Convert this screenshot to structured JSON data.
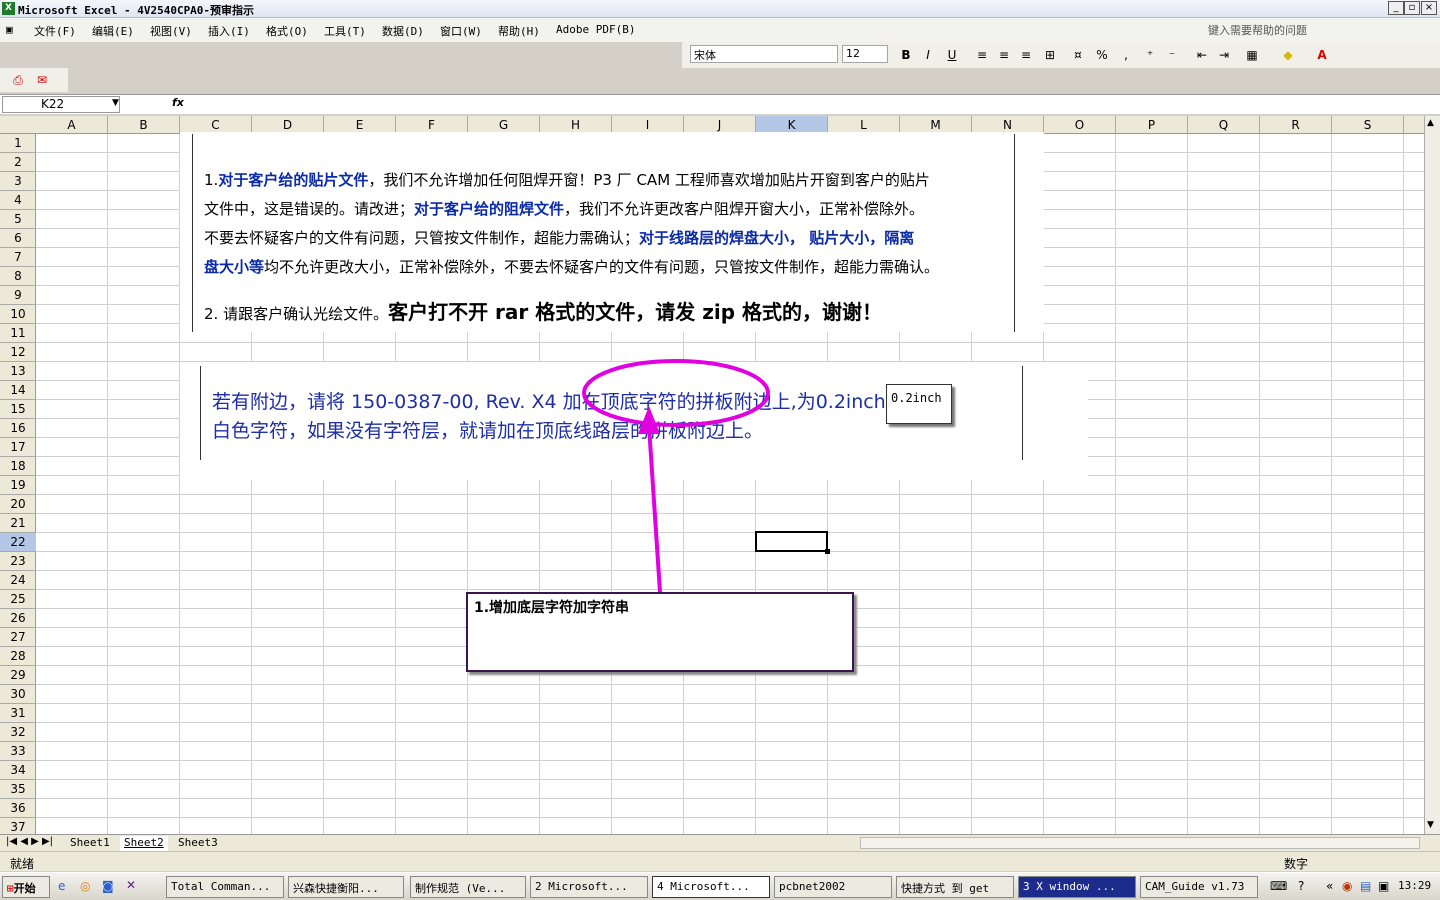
{
  "window": {
    "title": "Microsoft Excel - 4V2540CPA0-预审指示"
  },
  "menu": [
    "文件(F)",
    "编辑(E)",
    "视图(V)",
    "插入(I)",
    "格式(O)",
    "工具(T)",
    "数据(D)",
    "窗口(W)",
    "帮助(H)",
    "Adobe PDF(B)"
  ],
  "help_placeholder": "键入需要帮助的问题",
  "format": {
    "font": "宋体",
    "size": "12",
    "bold": "B",
    "italic": "I",
    "underline": "U",
    "percent": "%",
    "comma": ","
  },
  "formula": {
    "cell": "K22",
    "fx": "fx",
    "value": ""
  },
  "columns": [
    "A",
    "B",
    "C",
    "D",
    "E",
    "F",
    "G",
    "H",
    "I",
    "J",
    "K",
    "L",
    "M",
    "N",
    "O",
    "P",
    "Q",
    "R",
    "S"
  ],
  "selected_column": "K",
  "rows": [
    "1",
    "2",
    "3",
    "4",
    "5",
    "6",
    "7",
    "8",
    "9",
    "10",
    "11",
    "12",
    "13",
    "14",
    "15",
    "16",
    "17",
    "18",
    "19",
    "20",
    "21",
    "22",
    "23",
    "24",
    "25",
    "26",
    "27",
    "28",
    "29",
    "30",
    "31",
    "32",
    "33",
    "34",
    "35",
    "36",
    "37"
  ],
  "selected_row": "22",
  "doc1": {
    "l1a": "1.",
    "l1b": "对于客户给的贴片文件",
    "l1c": "，我们不允许增加任何阻焊开窗！P3 厂 CAM 工程师喜欢增加贴片开窗到客户的贴片",
    "l2a": "文件中，这是错误的。请改进；",
    "l2b": "对于客户给的阻焊文件",
    "l2c": "，我们不允许更改客户阻焊开窗大小，正常补偿除外。",
    "l3a": "不要去怀疑客户的文件有问题，只管按文件制作，超能力需确认；",
    "l3b": "对于线路层的焊盘大小， 贴片大小，隔离",
    "l4a": "盘大小等",
    "l4b": "均不允许更改大小，正常补偿除外，不要去怀疑客户的文件有问题，只管按文件制作，超能力需确认。",
    "l5a": "2. 请跟客户确认光绘文件。",
    "l5b": "客户打不开 rar 格式的文件，请发 zip 格式的，谢谢！"
  },
  "doc2": {
    "l1": "若有附边，请将 150-0387-00, Rev. X4 加在顶底字符的拼板附边上,为0.2inch高度的",
    "l2": "白色字符，如果没有字符层，就请加在顶底线路层的拼板附边上。"
  },
  "note": "0.2inch",
  "callout": "1.增加底层字符加字符串",
  "sheet_tabs": [
    "Sheet1",
    "Sheet2",
    "Sheet3"
  ],
  "active_tab": "Sheet2",
  "status": {
    "left": "就绪",
    "right": "数字"
  },
  "taskbar": {
    "start": "开始",
    "tasks": [
      "Total Comman...",
      "兴森快捷衡阳...",
      "制作规范 (Ve...",
      "2 Microsoft...",
      "4 Microsoft...",
      "pcbnet2002",
      "快捷方式 到 get",
      "3 X window ...",
      "CAM_Guide v1.73"
    ],
    "clock": "13:29"
  },
  "colors": {
    "annotation": "#e000e0",
    "blue_text": "#1d2ea6"
  }
}
